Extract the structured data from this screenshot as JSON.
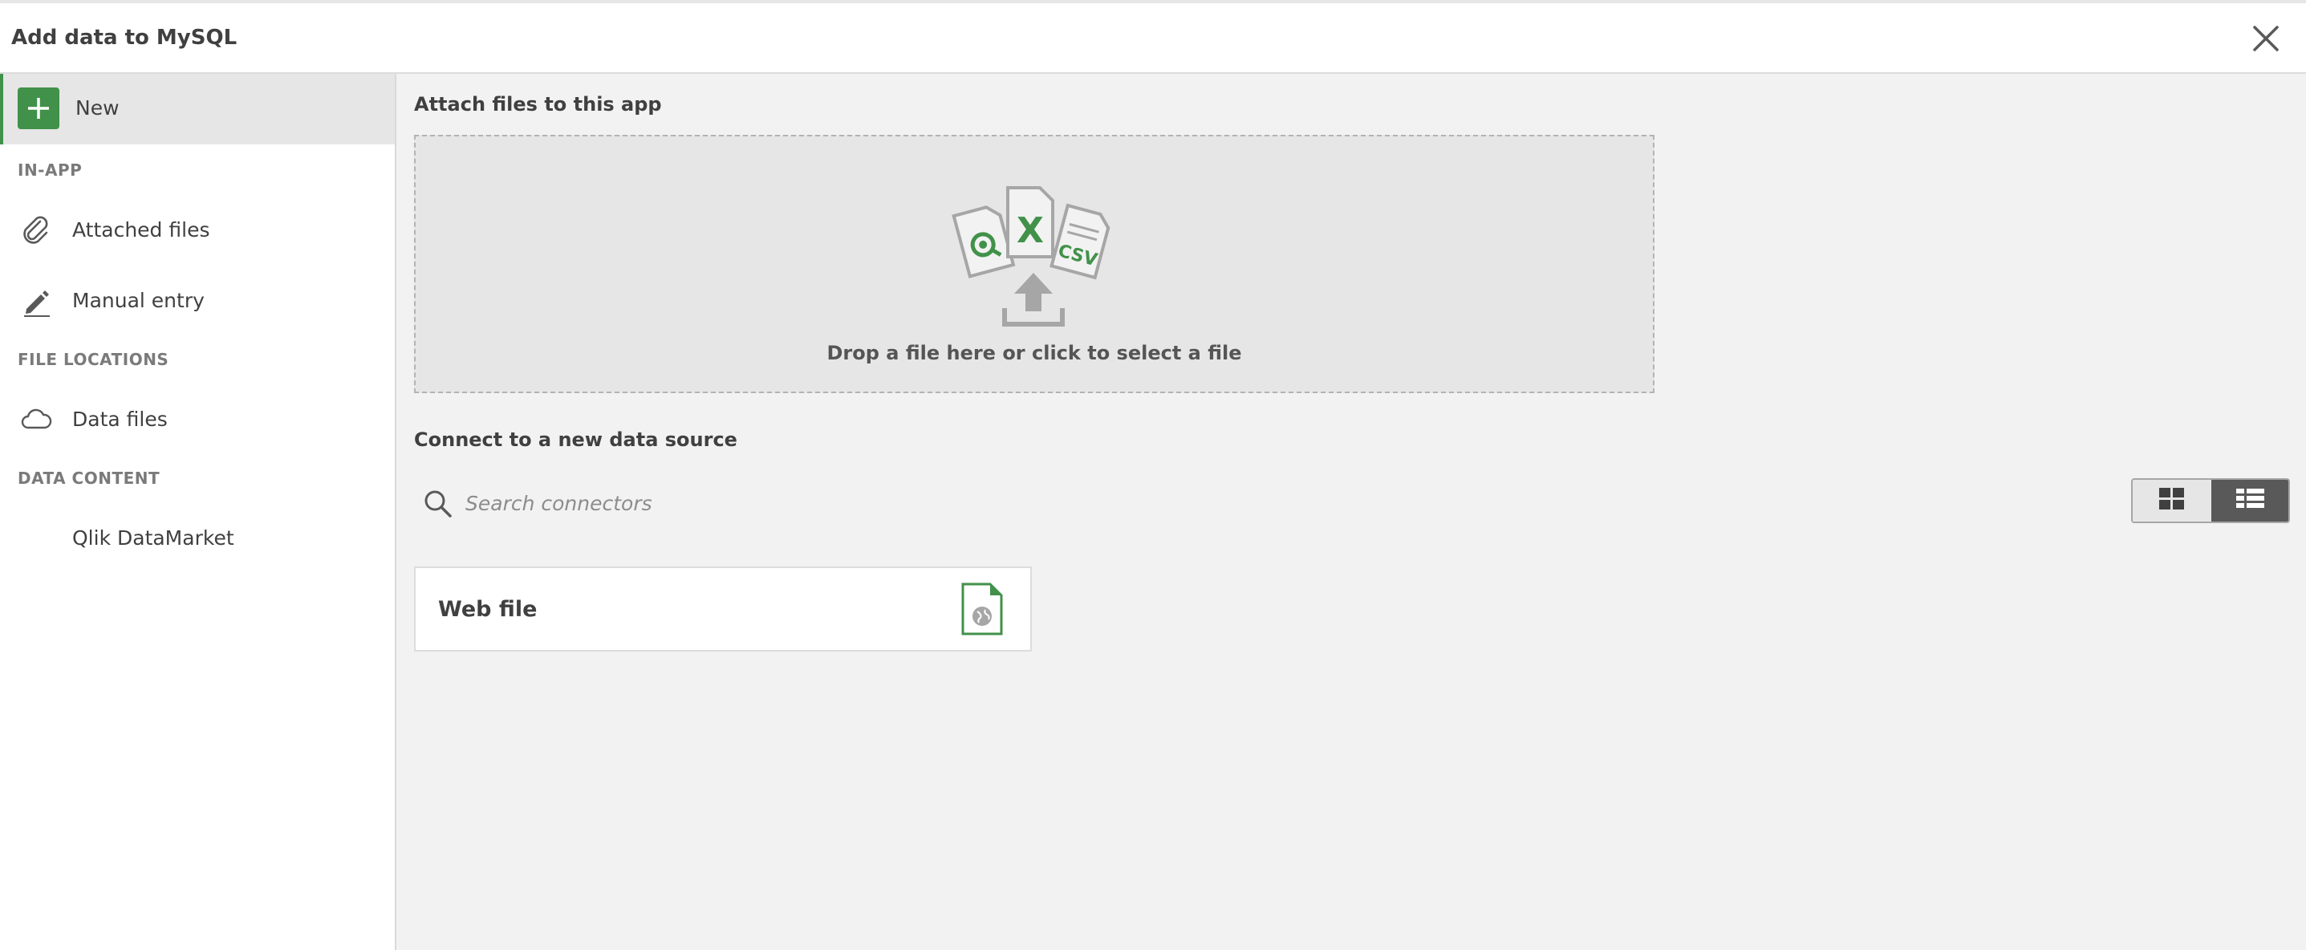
{
  "header": {
    "title": "Add data to MySQL"
  },
  "sidebar": {
    "new_label": "New",
    "sections": [
      {
        "label": "IN-APP"
      },
      {
        "label": "FILE LOCATIONS"
      },
      {
        "label": "DATA CONTENT"
      }
    ],
    "items": [
      {
        "label": "Attached files",
        "icon": "paperclip-icon"
      },
      {
        "label": "Manual entry",
        "icon": "pencil-icon"
      },
      {
        "label": "Data files",
        "icon": "cloud-icon"
      },
      {
        "label": "Qlik DataMarket",
        "icon": ""
      }
    ]
  },
  "main": {
    "attach_title": "Attach files to this app",
    "dropzone_text": "Drop a file here or click to select a file",
    "dropzone_icon_texts": {
      "excel": "X",
      "csv": "CSV"
    },
    "connect_title": "Connect to a new data source",
    "search": {
      "placeholder": "Search connectors",
      "value": ""
    },
    "view_toggle": {
      "selected": "list"
    },
    "connectors": [
      {
        "label": "Web file",
        "icon": "web-file-icon"
      }
    ]
  },
  "colors": {
    "accent_green": "#41914a",
    "selected_bg": "#e6e6e6",
    "toggle_active": "#595959"
  }
}
